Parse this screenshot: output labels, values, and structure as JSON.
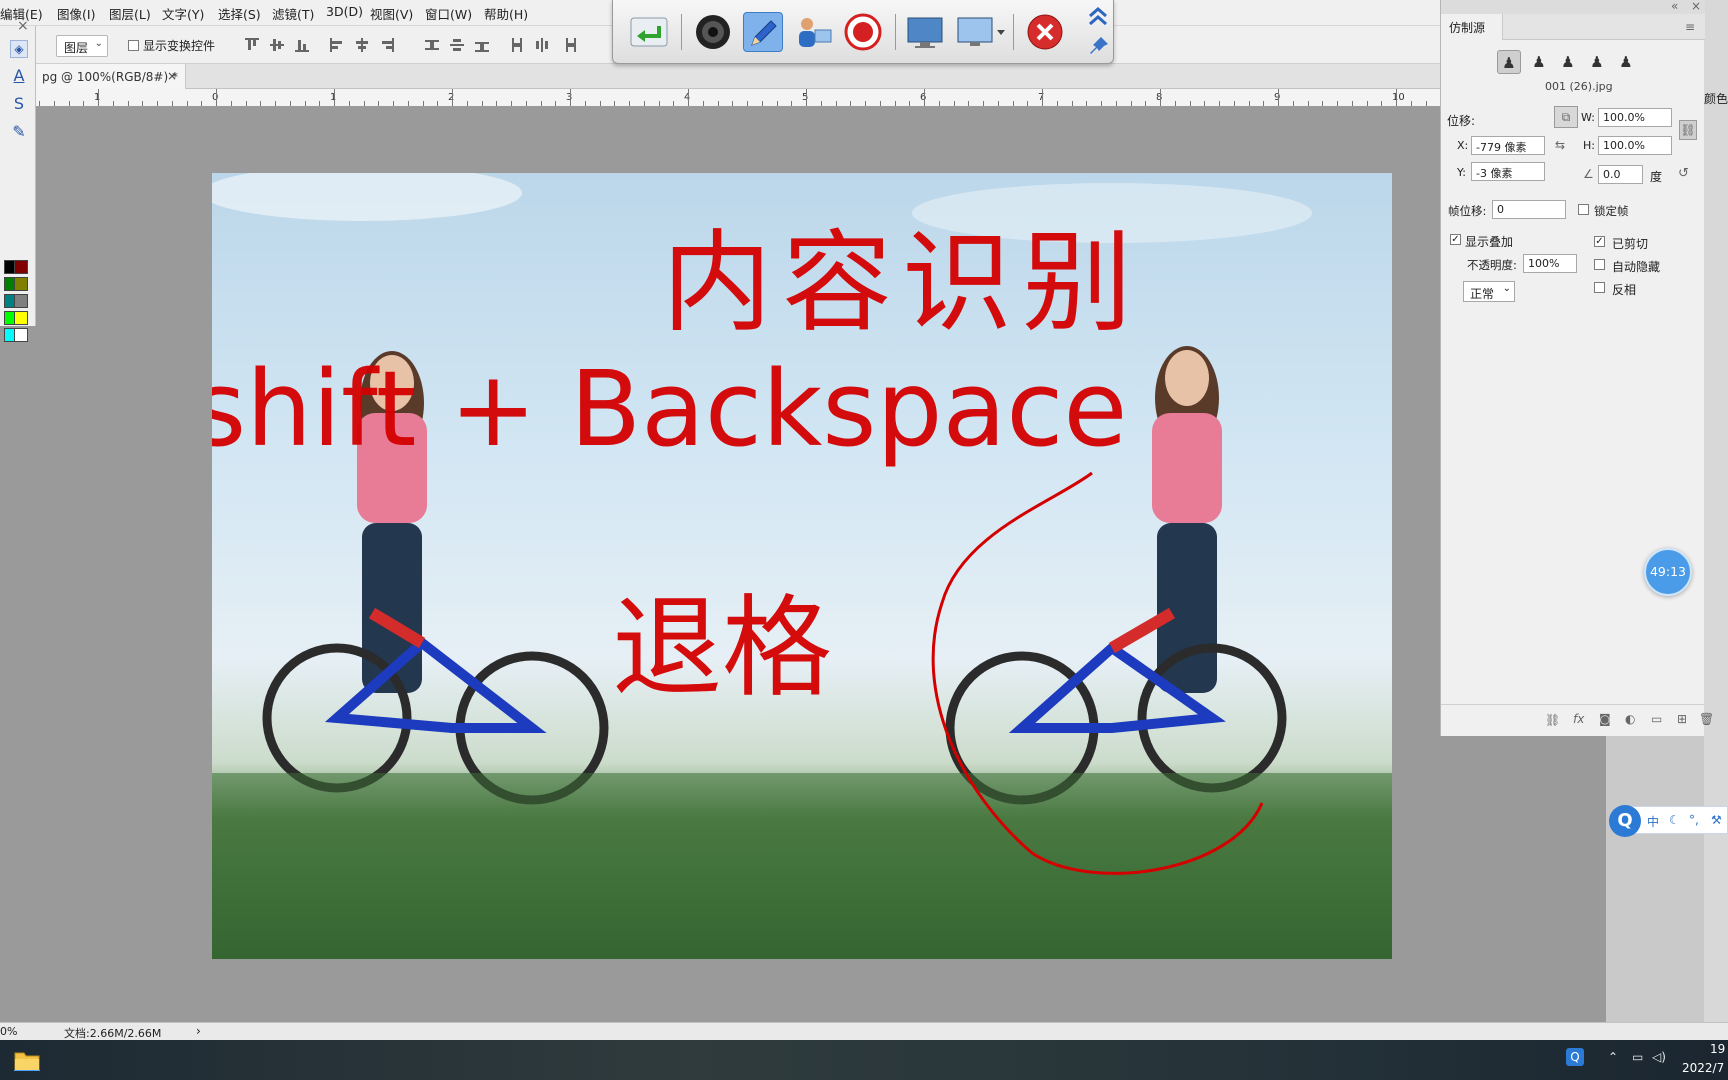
{
  "menubar": {
    "items": [
      "编辑(E)",
      "图像(I)",
      "图层(L)",
      "文字(Y)",
      "选择(S)",
      "滤镜(T)",
      "3D(D)",
      "视图(V)",
      "窗口(W)",
      "帮助(H)"
    ]
  },
  "options_bar": {
    "auto_select_value": "图层",
    "show_transform_label": "显示变换控件"
  },
  "document_tab": {
    "label": "pg @ 100%(RGB/8#) *",
    "close": "×"
  },
  "ruler": {
    "numbers": [
      "1",
      "0",
      "1",
      "2",
      "3",
      "4",
      "5",
      "6",
      "7",
      "8",
      "9",
      "10"
    ]
  },
  "swatches": [
    "#000000",
    "#800000",
    "#008000",
    "#808000",
    "#008080",
    "#808080",
    "#00ff00",
    "#ffff00",
    "#00ffff",
    "#ffffff"
  ],
  "canvas": {
    "annotation_line1": "内容识别",
    "annotation_line2": "shift + Backspace",
    "annotation_line3": "退格",
    "annotation_color": "#d40000"
  },
  "recorder_toolbar": {
    "buttons": [
      "return-icon",
      "camera-lens-icon",
      "pen-icon",
      "presenter-icon",
      "record-icon",
      "fullscreen-icon",
      "screen-select-icon",
      "close-icon"
    ],
    "collapse_icon": "double-chevron-up-icon",
    "pin_icon": "pin-icon"
  },
  "clone_source": {
    "tab_label": "仿制源",
    "source_file": "001 (26).jpg",
    "offset_label": "位移:",
    "x_label": "X:",
    "x_value": "-779 像素",
    "y_label": "Y:",
    "y_value": "-3 像素",
    "w_label": "W:",
    "w_value": "100.0%",
    "h_label": "H:",
    "h_value": "100.0%",
    "angle_value": "0.0",
    "angle_unit": "度",
    "frame_offset_label": "帧位移:",
    "frame_offset_value": "0",
    "lock_frame_label": "锁定帧",
    "show_overlay_label": "显示叠加",
    "show_overlay_checked": true,
    "opacity_label": "不透明度:",
    "opacity_value": "100%",
    "clipped_label": "已剪切",
    "clipped_checked": true,
    "auto_hide_label": "自动隐藏",
    "invert_label": "反相",
    "blend_mode": "正常"
  },
  "right_dock": {
    "color_label": "颜色"
  },
  "statusbar": {
    "zoom": "0%",
    "doc_size": "文档:2.66M/2.66M"
  },
  "timer": {
    "value": "49:13"
  },
  "ime": {
    "mode": "中"
  },
  "taskbar": {
    "time": "19",
    "date": "2022/7"
  }
}
